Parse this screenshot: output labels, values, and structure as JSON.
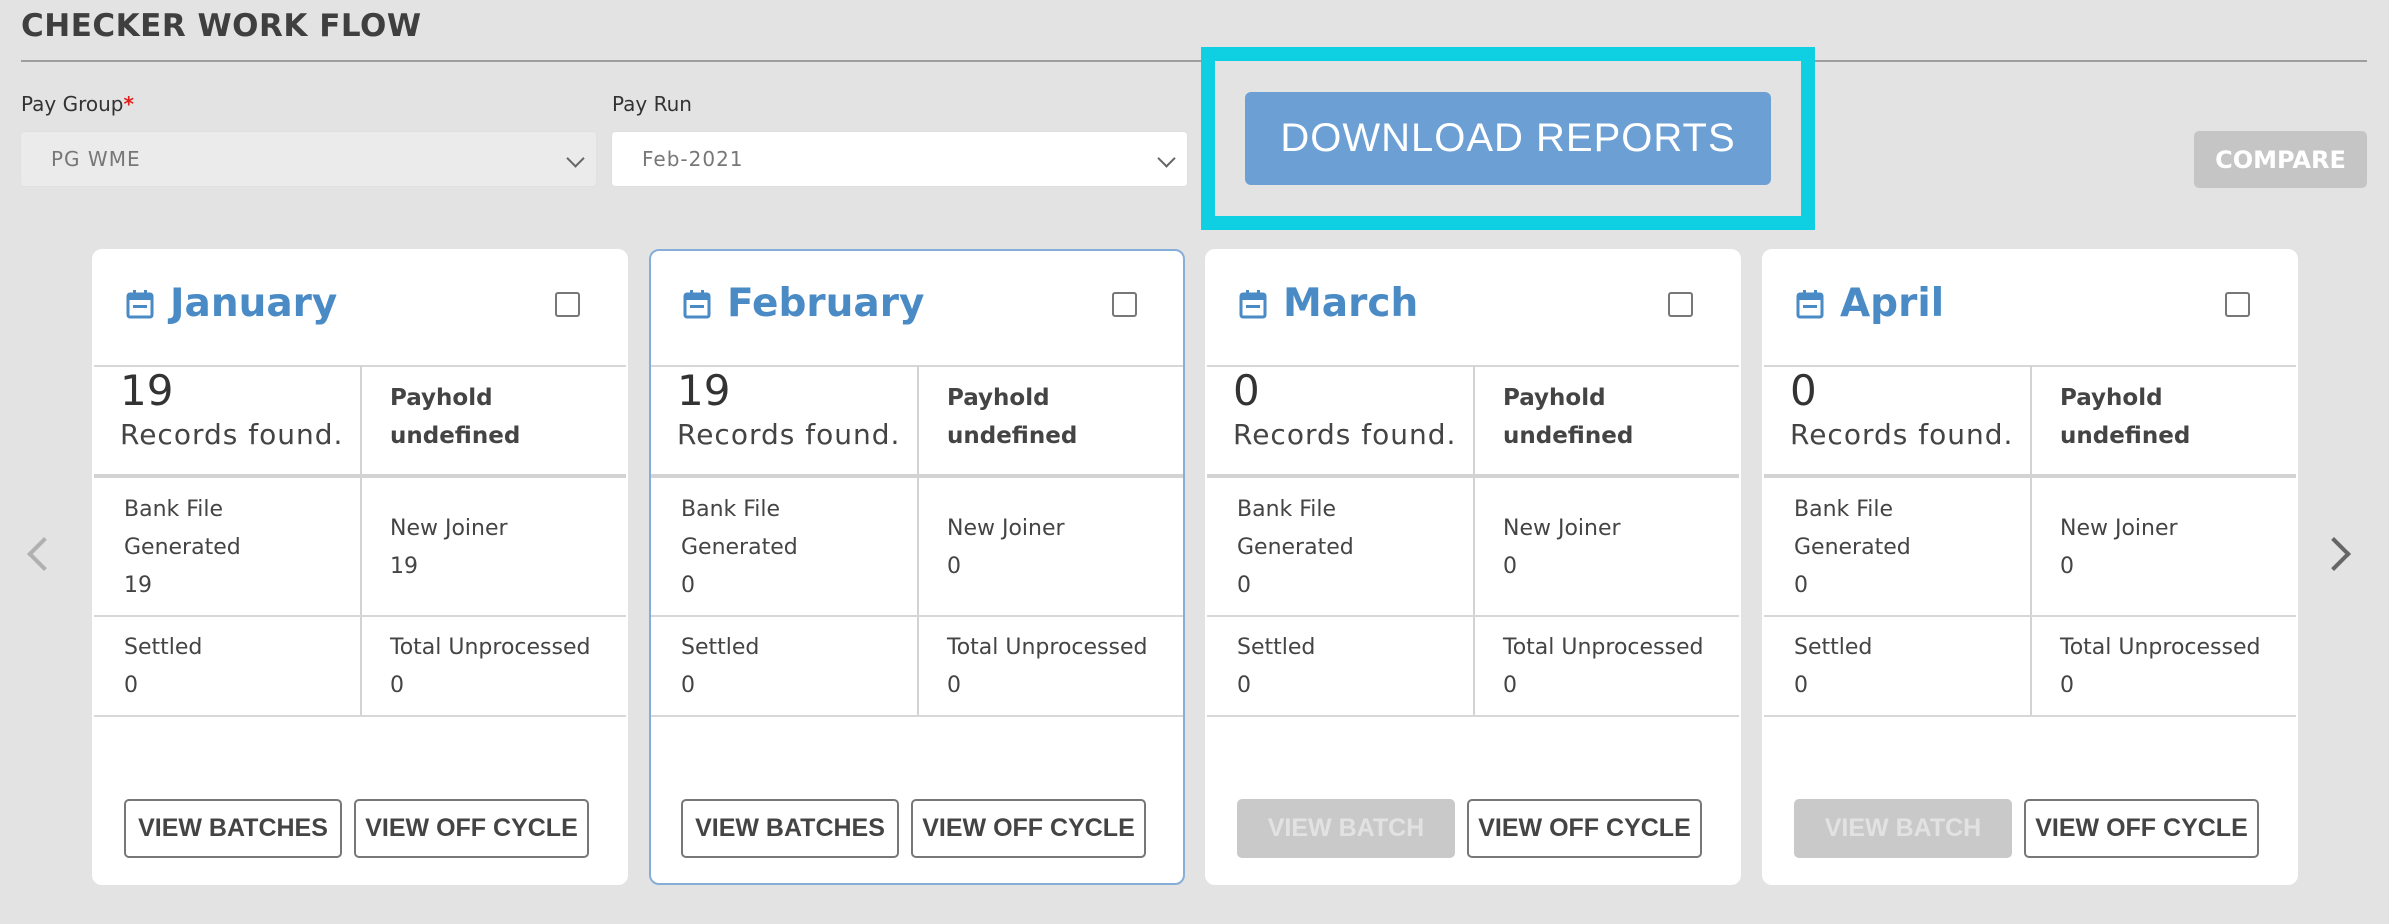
{
  "page": {
    "title": "CHECKER WORK FLOW"
  },
  "filters": {
    "pay_group": {
      "label": "Pay Group",
      "required_mark": "*",
      "value": "PG WME"
    },
    "pay_run": {
      "label": "Pay Run",
      "value": "Feb-2021"
    }
  },
  "actions": {
    "download_reports": "DOWNLOAD REPORTS",
    "compare": "COMPARE"
  },
  "colors": {
    "accent": "#4a8bc6",
    "highlight": "#0fd0e3",
    "download_button": "#6c9fd4"
  },
  "cards": [
    {
      "month": "January",
      "records_count": "19",
      "records_text": "Records found.",
      "payhold_label": "Payhold",
      "payhold_value": "undefined",
      "bank_file_label_1": "Bank File",
      "bank_file_label_2": "Generated",
      "bank_file_value": "19",
      "new_joiner_label": "New Joiner",
      "new_joiner_value": "19",
      "settled_label": "Settled",
      "settled_value": "0",
      "total_unprocessed_label": "Total Unprocessed",
      "total_unprocessed_value": "0",
      "button_1": "VIEW BATCHES",
      "button_2": "VIEW OFF CYCLE"
    },
    {
      "month": "February",
      "records_count": "19",
      "records_text": "Records found.",
      "payhold_label": "Payhold",
      "payhold_value": "undefined",
      "bank_file_label_1": "Bank File",
      "bank_file_label_2": "Generated",
      "bank_file_value": "0",
      "new_joiner_label": "New Joiner",
      "new_joiner_value": "0",
      "settled_label": "Settled",
      "settled_value": "0",
      "total_unprocessed_label": "Total Unprocessed",
      "total_unprocessed_value": "0",
      "button_1": "VIEW BATCHES",
      "button_2": "VIEW OFF CYCLE"
    },
    {
      "month": "March",
      "records_count": "0",
      "records_text": "Records found.",
      "payhold_label": "Payhold",
      "payhold_value": "undefined",
      "bank_file_label_1": "Bank File",
      "bank_file_label_2": "Generated",
      "bank_file_value": "0",
      "new_joiner_label": "New Joiner",
      "new_joiner_value": "0",
      "settled_label": "Settled",
      "settled_value": "0",
      "total_unprocessed_label": "Total Unprocessed",
      "total_unprocessed_value": "0",
      "button_1": "VIEW BATCH",
      "button_2": "VIEW OFF CYCLE"
    },
    {
      "month": "April",
      "records_count": "0",
      "records_text": "Records found.",
      "payhold_label": "Payhold",
      "payhold_value": "undefined",
      "bank_file_label_1": "Bank File",
      "bank_file_label_2": "Generated",
      "bank_file_value": "0",
      "new_joiner_label": "New Joiner",
      "new_joiner_value": "0",
      "settled_label": "Settled",
      "settled_value": "0",
      "total_unprocessed_label": "Total Unprocessed",
      "total_unprocessed_value": "0",
      "button_1": "VIEW BATCH",
      "button_2": "VIEW OFF CYCLE"
    }
  ]
}
